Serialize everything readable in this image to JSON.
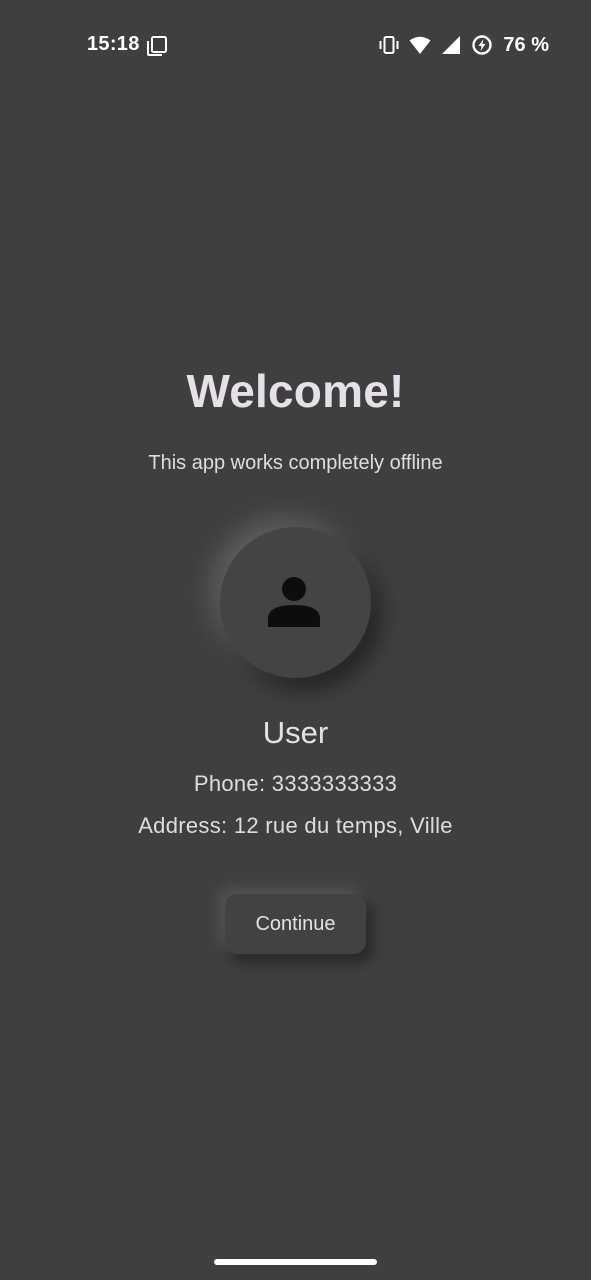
{
  "status_bar": {
    "time": "15:18",
    "battery": "76 %",
    "icons": [
      "notification-copy-icon",
      "vibrate-icon",
      "wifi-icon",
      "cell-signal-icon",
      "battery-saver-icon"
    ]
  },
  "main": {
    "title": "Welcome!",
    "subtitle": "This app works completely offline",
    "avatar_icon": "person-icon",
    "user_name": "User",
    "phone": "Phone: 3333333333",
    "address": "Address: 12 rue du temps, Ville",
    "continue_label": "Continue"
  },
  "colors": {
    "background": "#3f3f3f",
    "text": "#e6e1e8",
    "surface": "#444444"
  }
}
